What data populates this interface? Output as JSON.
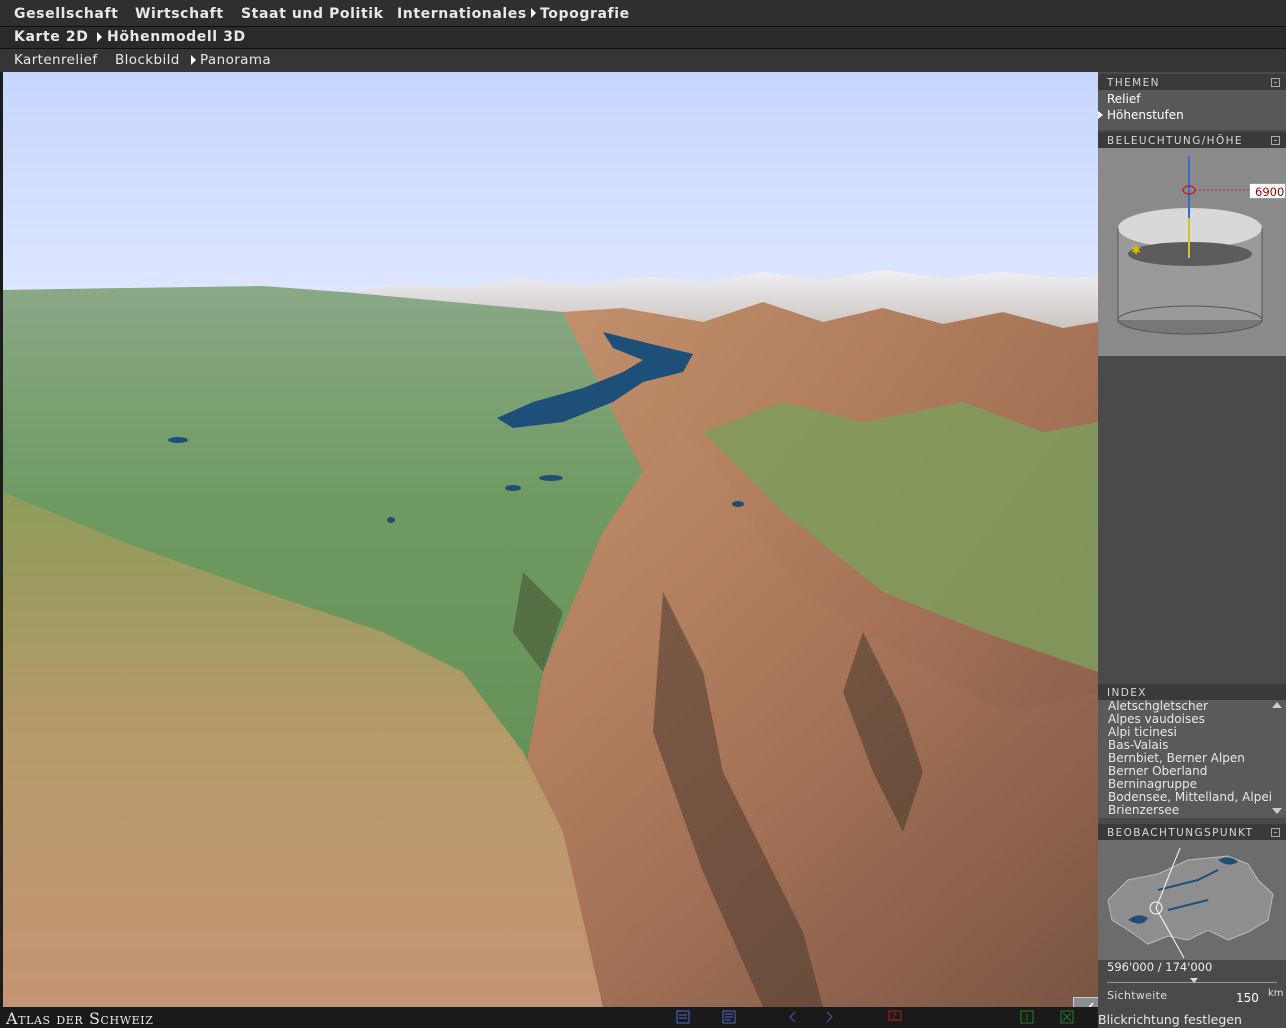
{
  "menu": {
    "row1": [
      {
        "label": "Gesellschaft",
        "active": false
      },
      {
        "label": "Wirtschaft",
        "active": false
      },
      {
        "label": "Staat und Politik",
        "active": false
      },
      {
        "label": "Internationales",
        "active": false
      },
      {
        "label": "Topografie",
        "active": true
      }
    ],
    "row2": [
      {
        "label": "Karte 2D",
        "active": false
      },
      {
        "label": "Höhenmodell 3D",
        "active": true
      }
    ],
    "row3": [
      {
        "label": "Kartenrelief",
        "active": false
      },
      {
        "label": "Blockbild",
        "active": false
      },
      {
        "label": "Panorama",
        "active": true
      }
    ]
  },
  "panel": {
    "themen": {
      "title": "THEMEN",
      "items": [
        "Relief",
        "Höhenstufen"
      ],
      "selected": "Höhenstufen"
    },
    "beleuchtung": {
      "title": "BELEUCHTUNG/HÖHE",
      "height_value": "6900"
    },
    "index": {
      "title": "INDEX",
      "items": [
        "Aletschgletscher",
        "Alpes vaudoises",
        "Alpi ticinesi",
        "Bas-Valais",
        "Bernbiet, Berner Alpen",
        "Berner Oberland",
        "Berninagruppe",
        "Bodensee, Mittelland, Alpei",
        "Brienzersee"
      ]
    },
    "beobachtung": {
      "title": "BEOBACHTUNGSPUNKT",
      "coordinates": "596'000 / 174'000",
      "sichtweite_label": "Sichtweite",
      "sichtweite_value": "150",
      "sichtweite_unit": "km"
    }
  },
  "status": {
    "logo": "Atlas der Schweiz",
    "message": "Blickrichtung festlegen"
  },
  "colors": {
    "sky": "#c9d8ff",
    "lake": "#1e4f78",
    "valley_green": "#6f9a62",
    "rock_brown": "#b07a5e",
    "snow": "#e6e6ec"
  },
  "icons": {
    "themen_pin": "pin-icon",
    "confirm": "check-icon",
    "status": [
      "legend-icon",
      "text-icon",
      "back-arrow-icon",
      "forward-arrow-icon",
      "help-icon",
      "info-icon",
      "close-icon"
    ]
  }
}
